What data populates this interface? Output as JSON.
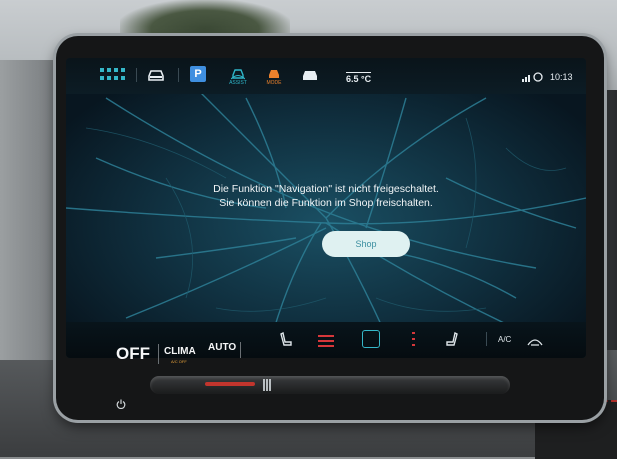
{
  "topbar": {
    "icons": {
      "apps": "apps-grid-icon",
      "car": "car-icon",
      "parking": "parking-icon",
      "assist": "assist-icon",
      "mode": "drive-mode-icon",
      "car_settings": "car-settings-icon",
      "signal": "signal-icon"
    },
    "parking_label": "P",
    "assist_label": "ASSIST",
    "mode_label": "MODE",
    "temperature": "6.5 °C",
    "time": "10:13"
  },
  "main": {
    "message_line1": "Die Funktion \"Navigation\" ist nicht freigeschaltet.",
    "message_line2": "Sie können die Funktion im Shop freischalten.",
    "shop_button": "Shop"
  },
  "bottombar": {
    "ac_label": "A/C",
    "icons": [
      "seat-left-icon",
      "heated-seat-left-icon",
      "defrost-icon",
      "heated-seat-right-icon",
      "seat-right-icon",
      "recirculation-icon"
    ]
  },
  "hardkeys": {
    "off_label": "OFF",
    "clima_label": "CLIMA",
    "clima_sub": "A/C OFF",
    "auto_label": "AUTO"
  },
  "colors": {
    "accent": "#35b7c8",
    "mode": "#e9802c",
    "parking": "#3f8fe0",
    "heat": "#d6373a",
    "map_bg": "#0c1d28",
    "shop_button_bg": "#dff1f1"
  }
}
